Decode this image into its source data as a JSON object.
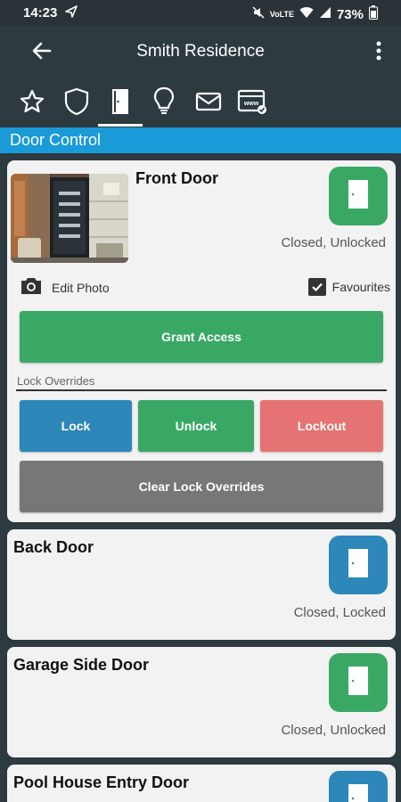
{
  "status_bar": {
    "time": "14:23",
    "network": "VoLTE",
    "battery": "73%"
  },
  "app_bar": {
    "title": "Smith Residence"
  },
  "tabs": [
    {
      "icon": "star-icon"
    },
    {
      "icon": "shield-icon"
    },
    {
      "icon": "door-icon",
      "active": true
    },
    {
      "icon": "lightbulb-icon"
    },
    {
      "icon": "mail-icon"
    },
    {
      "icon": "www-browser-icon"
    }
  ],
  "section": {
    "title": "Door Control"
  },
  "colors": {
    "green": "#3aa865",
    "blue": "#2d87b8",
    "red": "#e57373",
    "grey": "#777777",
    "header_blue": "#1a9bd7"
  },
  "doors": [
    {
      "name": "Front Door",
      "status": "Closed, Unlocked",
      "icon_color": "green",
      "edit_photo_label": "Edit Photo",
      "favourites_label": "Favourites",
      "favourites_checked": true,
      "grant_access_label": "Grant Access",
      "lock_overrides_label": "Lock Overrides",
      "lock_label": "Lock",
      "unlock_label": "Unlock",
      "lockout_label": "Lockout",
      "clear_label": "Clear Lock Overrides"
    },
    {
      "name": "Back Door",
      "status": "Closed, Locked",
      "icon_color": "blue"
    },
    {
      "name": "Garage Side Door",
      "status": "Closed, Unlocked",
      "icon_color": "green"
    },
    {
      "name": "Pool House Entry Door",
      "icon_color": "blue"
    }
  ]
}
